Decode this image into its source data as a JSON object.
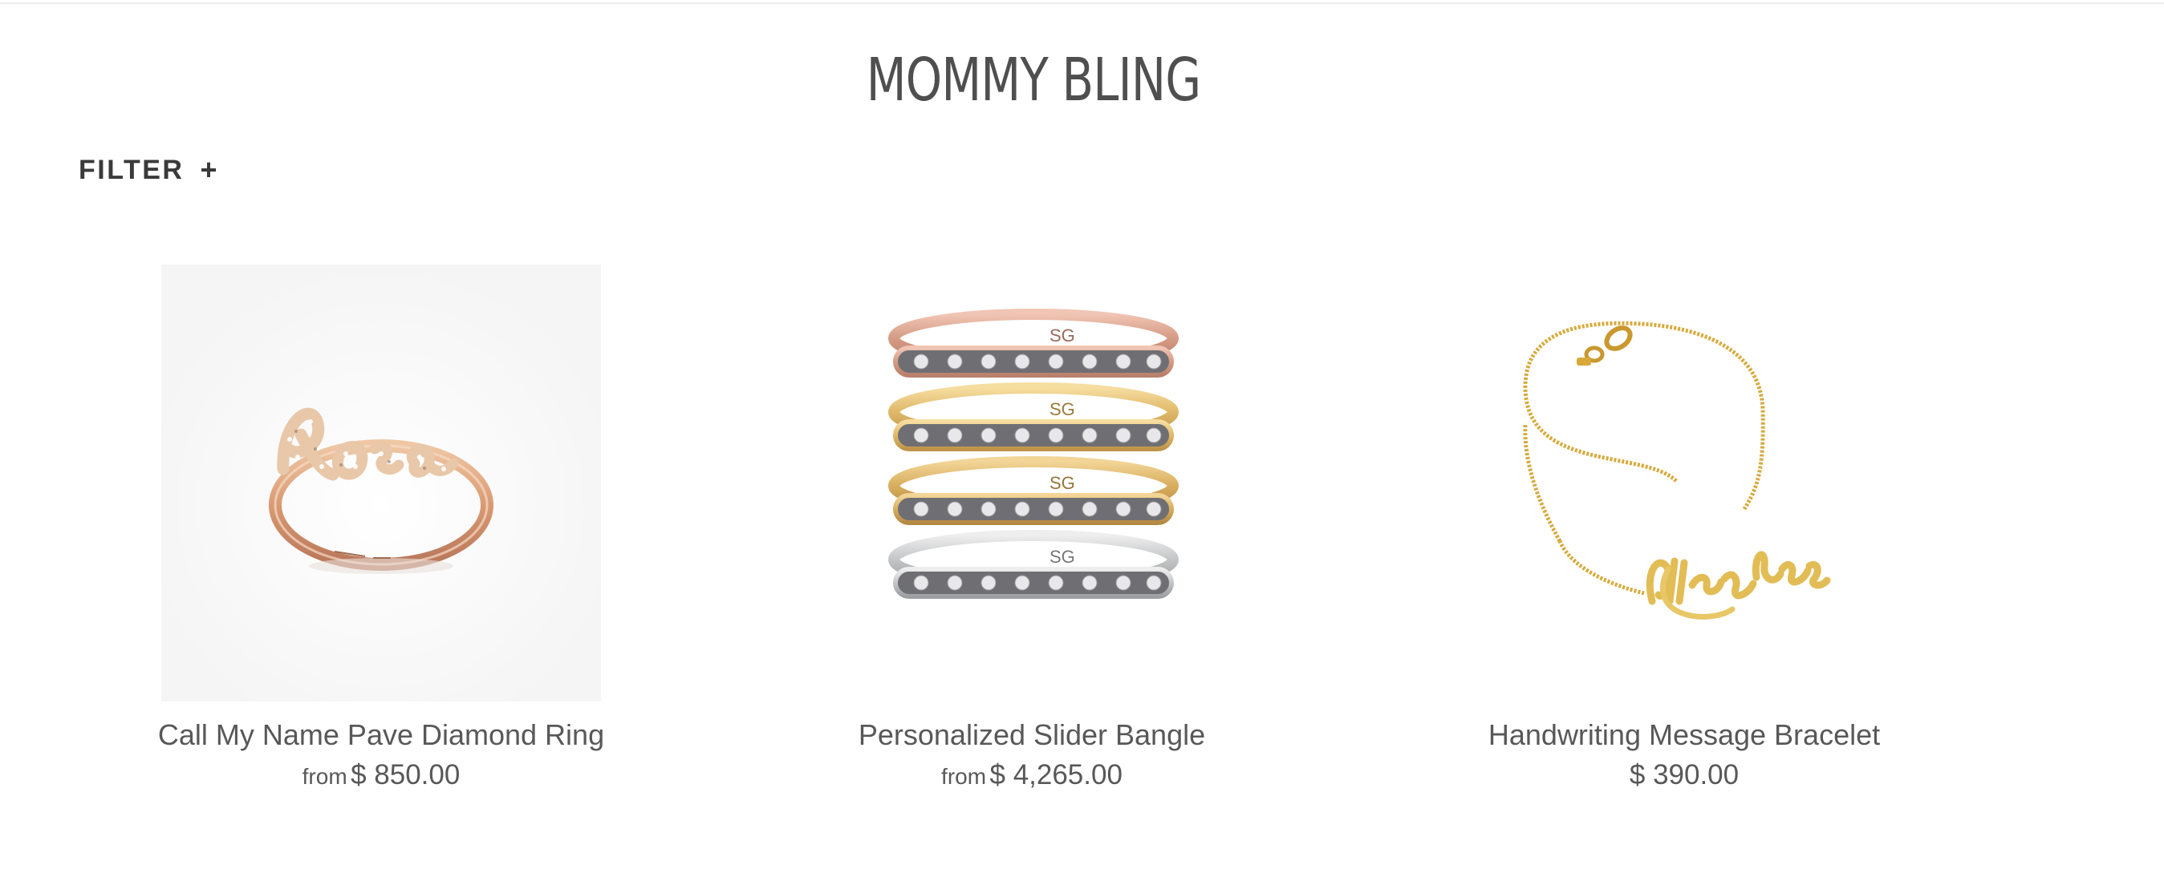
{
  "collection": {
    "title": "MOMMY BLING"
  },
  "filter": {
    "label": "FILTER",
    "toggle_symbol": "+"
  },
  "products": [
    {
      "name": "Call My Name Pave Diamond Ring",
      "price_prefix": "from",
      "price": "$ 850.00",
      "image_icon": "rose-gold-name-ring",
      "image_text": "Rose"
    },
    {
      "name": "Personalized Slider Bangle",
      "price_prefix": "from",
      "price": "$ 4,265.00",
      "image_icon": "stacked-slider-bangles",
      "image_text": "SG",
      "metal_colors": [
        "#d9a391",
        "#e3c27a",
        "#dcb86c",
        "#bfc0c2"
      ]
    },
    {
      "name": "Handwriting Message Bracelet",
      "price_prefix": "",
      "price": "$ 390.00",
      "image_icon": "gold-script-chain-bracelet",
      "image_text": "All my love"
    }
  ],
  "colors": {
    "text": "#585858",
    "title": "#4f4f4f",
    "divider": "#ececec"
  }
}
